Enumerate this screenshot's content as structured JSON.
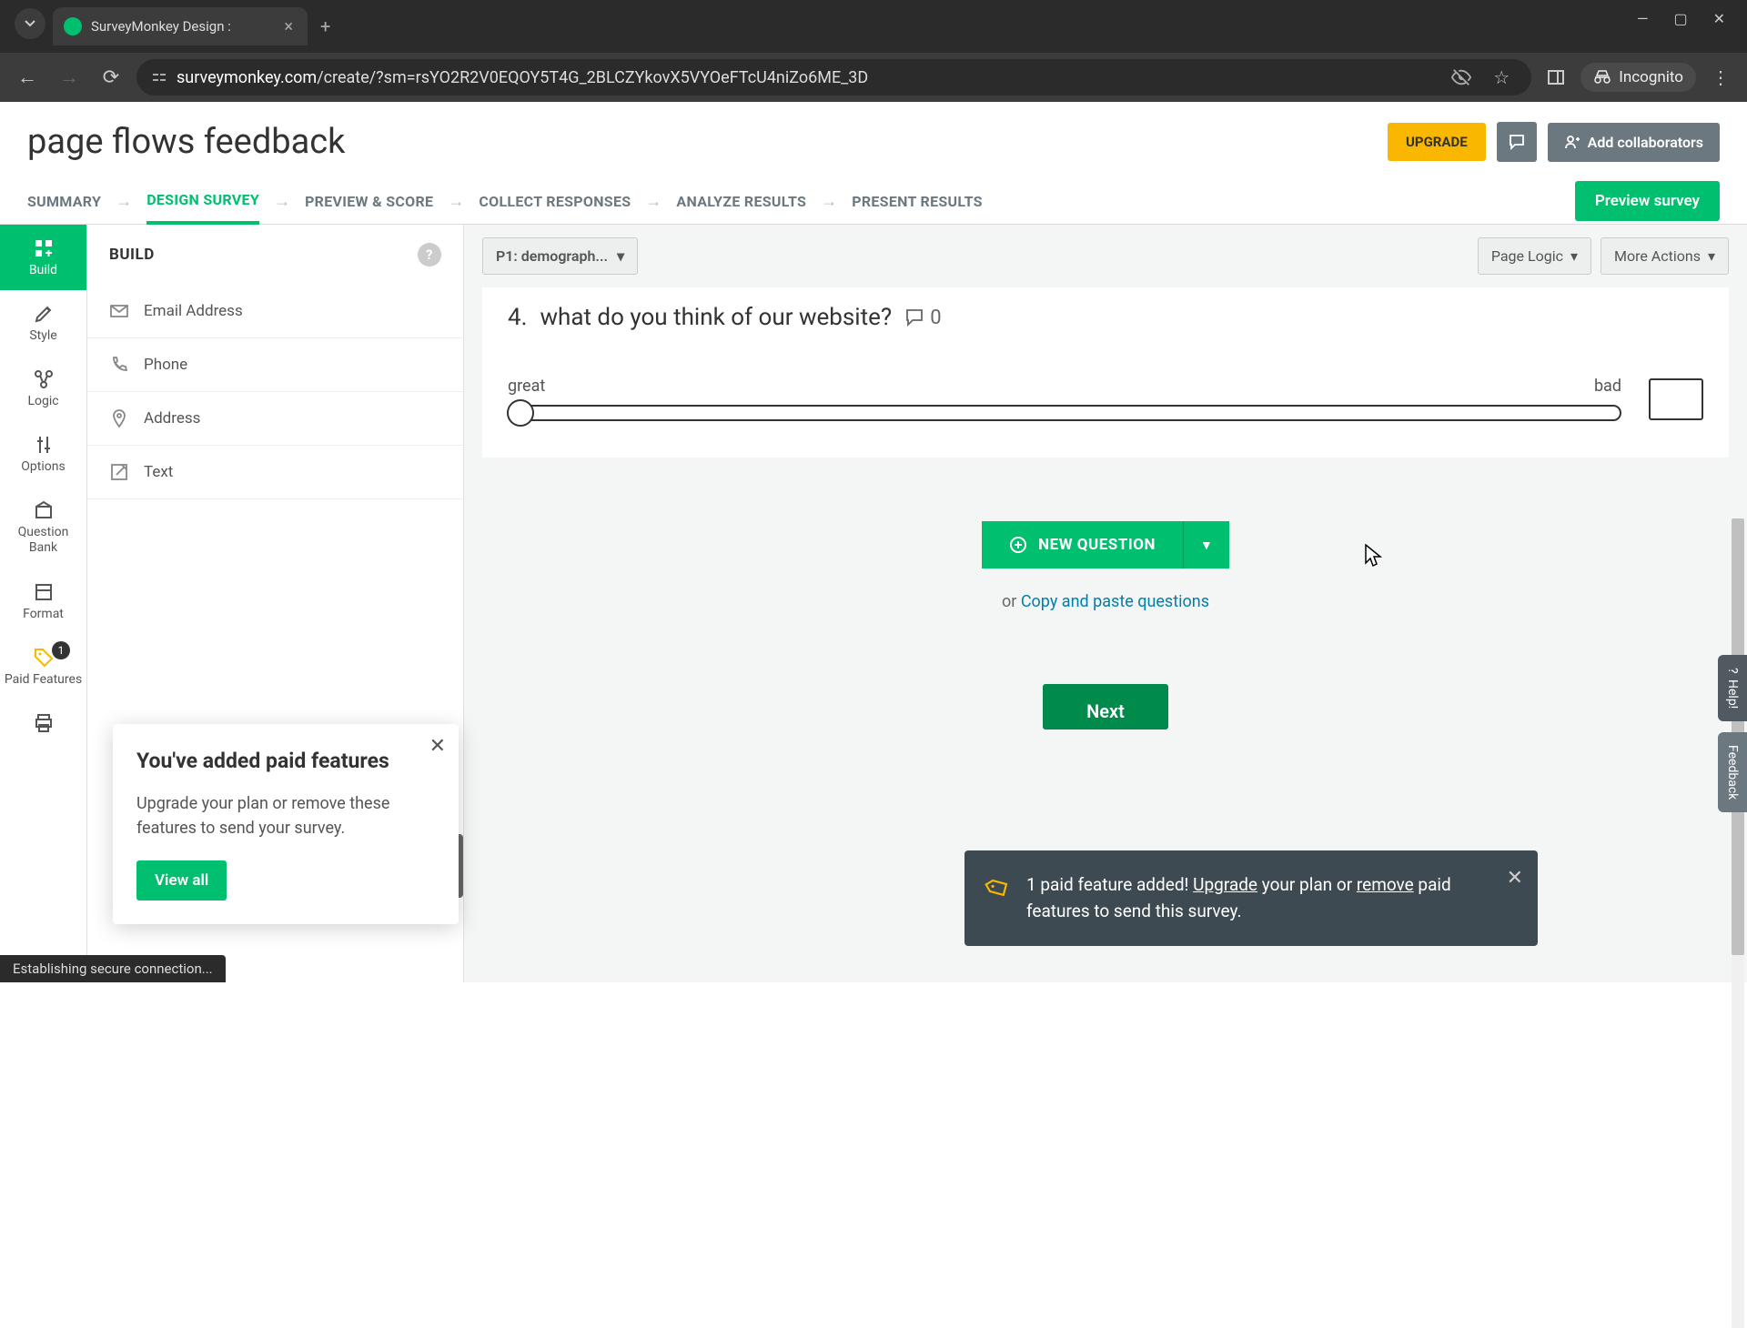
{
  "browser": {
    "tab_title": "SurveyMonkey Design :",
    "url_domain": "surveymonkey.com",
    "url_path": "/create/?sm=rsYO2R2V0EQOY5T4G_2BLCZYkovX5VYOeFTcU4niZo6ME_3D",
    "incognito_label": "Incognito",
    "status_text": "Establishing secure connection..."
  },
  "header": {
    "survey_title": "page flows feedback",
    "upgrade_label": "UPGRADE",
    "collab_label": "Add collaborators"
  },
  "nav": {
    "tabs": [
      "SUMMARY",
      "DESIGN SURVEY",
      "PREVIEW & SCORE",
      "COLLECT RESPONSES",
      "ANALYZE RESULTS",
      "PRESENT RESULTS"
    ],
    "active_index": 1,
    "preview_label": "Preview survey"
  },
  "rail": {
    "items": [
      {
        "label": "Build"
      },
      {
        "label": "Style"
      },
      {
        "label": "Logic"
      },
      {
        "label": "Options"
      },
      {
        "label": "Question Bank"
      },
      {
        "label": "Format"
      },
      {
        "label": "Paid Features",
        "badge": "1"
      },
      {
        "label": ""
      }
    ]
  },
  "build": {
    "title": "BUILD",
    "items": [
      {
        "label": "Email Address"
      },
      {
        "label": "Phone"
      },
      {
        "label": "Address"
      },
      {
        "label": "Text"
      }
    ]
  },
  "canvas": {
    "page_picker": "P1: demograph...",
    "page_logic_label": "Page Logic",
    "more_actions_label": "More Actions",
    "question_number": "4.",
    "question_text": "what do you think of our website?",
    "comments_count": "0",
    "slider_left": "great",
    "slider_right": "bad",
    "new_question_label": "NEW QUESTION",
    "or_text": "or ",
    "copy_paste_label": "Copy and paste questions",
    "next_label": "Next"
  },
  "paid_popup": {
    "title": "You've added paid features",
    "body": "Upgrade your plan or remove these features to send your survey.",
    "cta": "View all"
  },
  "toast": {
    "prefix": "1 paid feature added! ",
    "upgrade": "Upgrade",
    "mid": " your plan or ",
    "remove": "remove",
    "suffix": " paid features to send this survey."
  },
  "side_tabs": {
    "help": "Help!",
    "feedback": "Feedback"
  }
}
